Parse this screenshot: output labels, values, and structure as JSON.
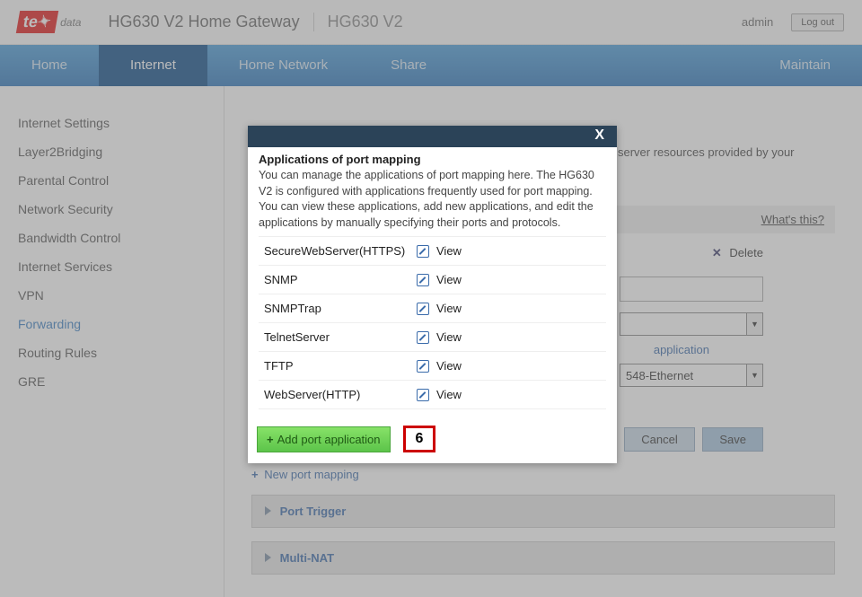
{
  "header": {
    "logo_prefix": "te",
    "logo_suffix": "data",
    "title": "HG630 V2 Home Gateway",
    "subtitle": "HG630 V2",
    "user": "admin",
    "logout": "Log out"
  },
  "nav": {
    "items": [
      "Home",
      "Internet",
      "Home Network",
      "Share"
    ],
    "active_index": 1,
    "right": "Maintain"
  },
  "sidebar": {
    "items": [
      "Internet Settings",
      "Layer2Bridging",
      "Parental Control",
      "Network Security",
      "Bandwidth Control",
      "Internet Services",
      "VPN",
      "Forwarding",
      "Routing Rules",
      "GRE"
    ],
    "active_index": 7
  },
  "background_page": {
    "you_can_suffix": "server resources provided by your computer",
    "whats_this": "What's this?",
    "delete_label": "Delete",
    "application_hint": "application",
    "interface_value": "548-Ethernet",
    "cancel": "Cancel",
    "save": "Save",
    "new_port_mapping": "New port mapping",
    "port_trigger": "Port Trigger",
    "multi_nat": "Multi-NAT"
  },
  "modal": {
    "close": "X",
    "title": "Applications of port mapping",
    "desc": "You can manage the applications of port mapping here. The HG630 V2 is configured with applications frequently used for port mapping. You can view these applications, add new applications, and edit the applications by manually specifying their ports and protocols.",
    "apps": [
      {
        "name": "SecureWebServer(HTTPS)",
        "view": "View"
      },
      {
        "name": "SNMP",
        "view": "View"
      },
      {
        "name": "SNMPTrap",
        "view": "View"
      },
      {
        "name": "TelnetServer",
        "view": "View"
      },
      {
        "name": "TFTP",
        "view": "View"
      },
      {
        "name": "WebServer(HTTP)",
        "view": "View"
      }
    ],
    "add_button": "Add port application",
    "callout": "6"
  }
}
